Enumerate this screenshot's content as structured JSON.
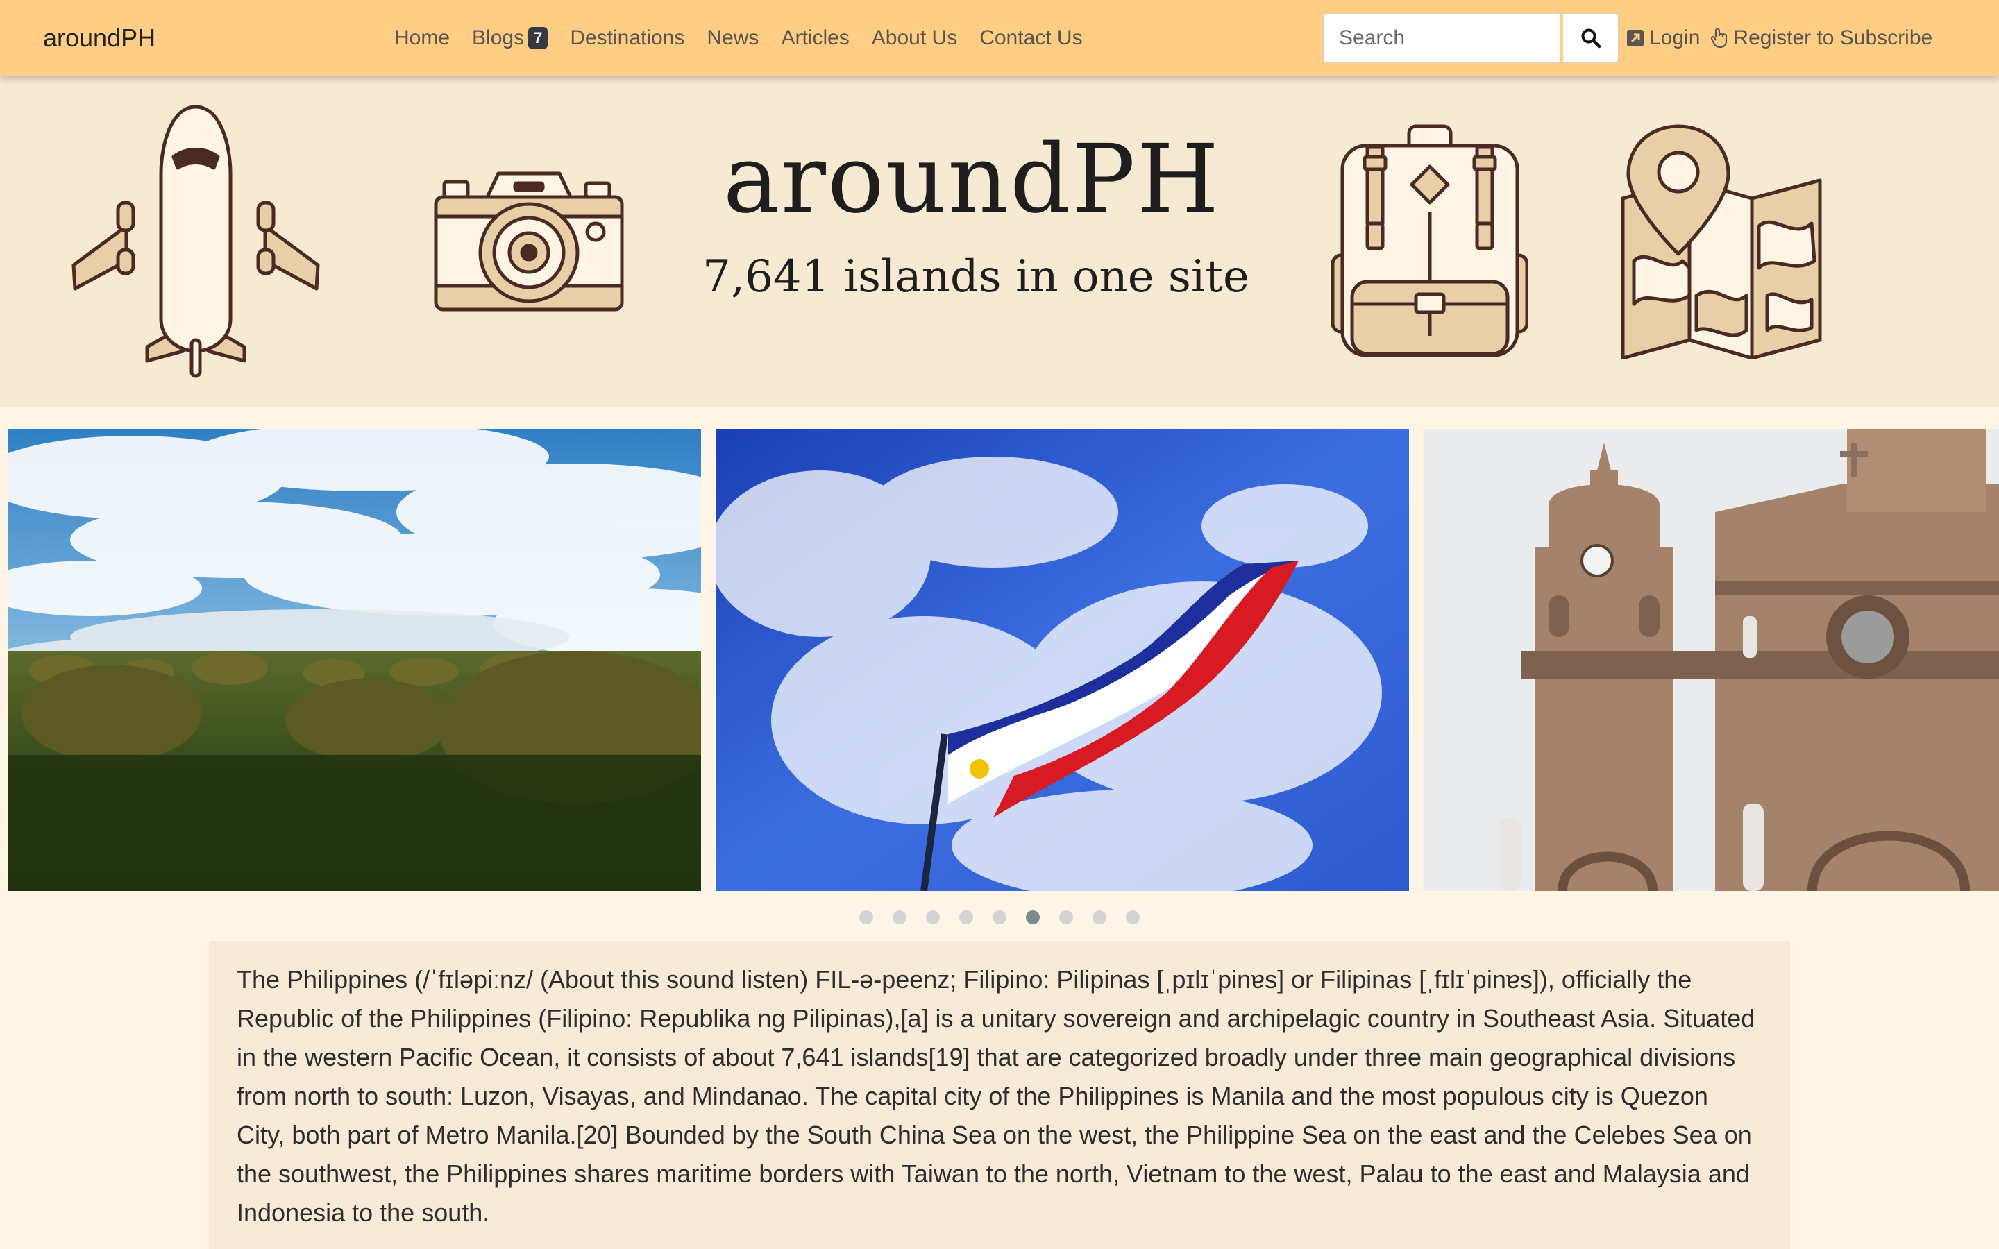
{
  "brand": "aroundPH",
  "nav": {
    "home": "Home",
    "blogs": "Blogs",
    "blogs_badge": "7",
    "destinations": "Destinations",
    "news": "News",
    "articles": "Articles",
    "about": "About Us",
    "contact": "Contact Us"
  },
  "search": {
    "placeholder": "Search",
    "value": ""
  },
  "auth": {
    "login": "Login",
    "register": "Register to Subscribe"
  },
  "hero": {
    "title": "aroundPH",
    "subtitle": "7,641 islands in one site",
    "icons": [
      "airplane-icon",
      "camera-icon",
      "backpack-icon",
      "map-icon"
    ]
  },
  "carousel": {
    "slides": [
      "chocolate-hills-photo",
      "philippine-flag-photo",
      "manila-cathedral-photo"
    ],
    "dot_count": 9,
    "active_index": 5
  },
  "intro": {
    "text": "The Philippines (/ˈfɪləpiːnz/ (About this sound listen) FIL-ə-peenz; Filipino: Pilipinas [ˌpɪlɪˈpinɐs] or Filipinas [ˌfɪlɪˈpinɐs]), officially the Republic of the Philippines (Filipino: Republika ng Pilipinas),[a] is a unitary sovereign and archipelagic country in Southeast Asia. Situated in the western Pacific Ocean, it consists of about 7,641 islands[19] that are categorized broadly under three main geographical divisions from north to south: Luzon, Visayas, and Mindanao. The capital city of the Philippines is Manila and the most populous city is Quezon City, both part of Metro Manila.[20] Bounded by the South China Sea on the west, the Philippine Sea on the east and the Celebes Sea on the southwest, the Philippines shares maritime borders with Taiwan to the north, Vietnam to the west, Palau to the east and Malaysia and Indonesia to the south."
  },
  "colors": {
    "navbar": "#ffce84",
    "hero_bg": "#f6ead2",
    "page_bg": "#fff5e6",
    "icon_stroke": "#4a2a22",
    "icon_fill": "#e7cfa8"
  }
}
